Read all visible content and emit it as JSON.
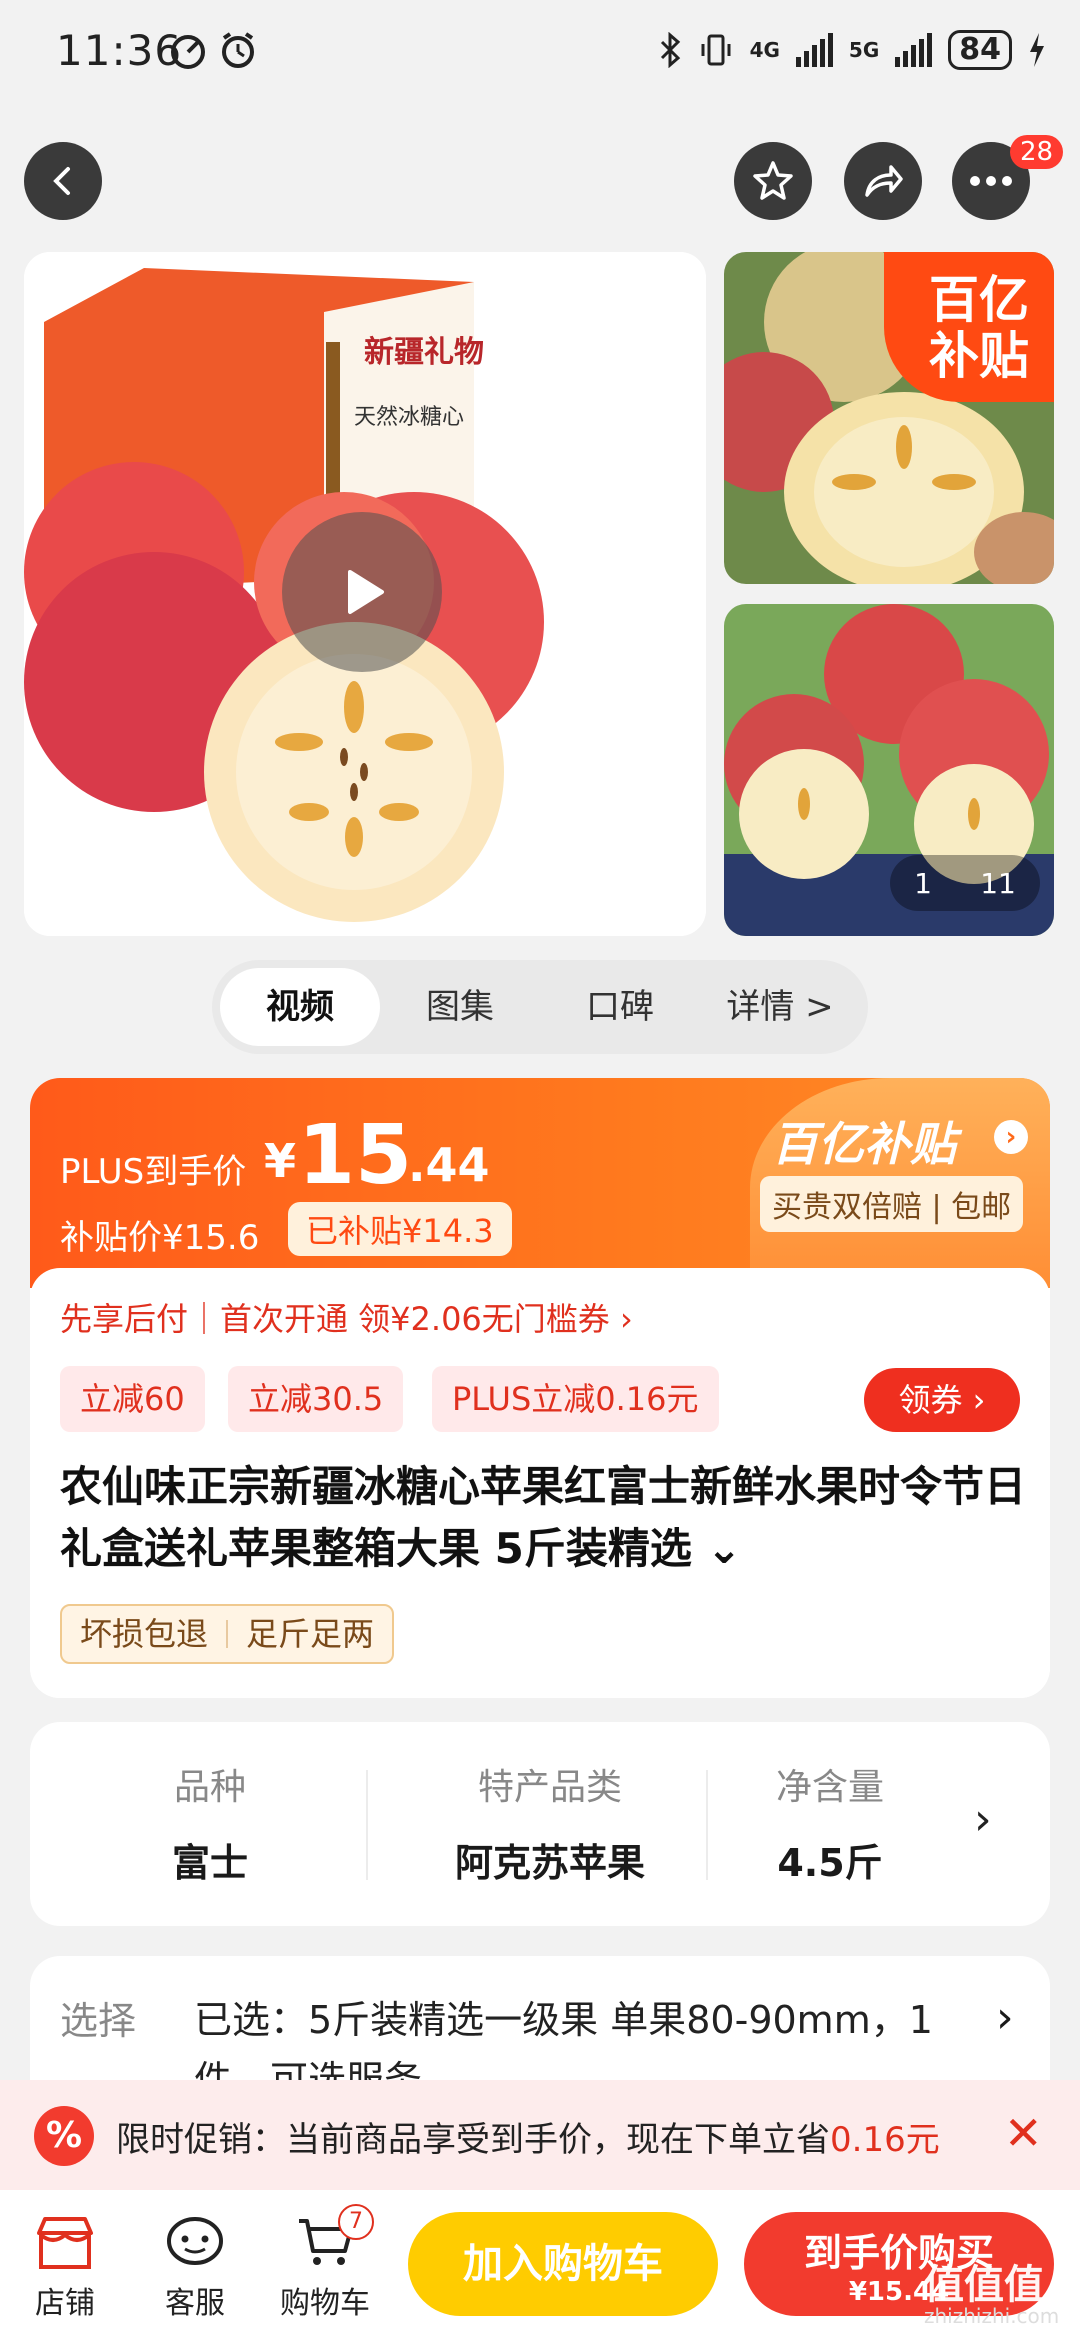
{
  "status_bar": {
    "time": "11:36",
    "network_1": "4G",
    "network_2": "5G",
    "battery": "84"
  },
  "nav": {
    "more_badge": "28"
  },
  "gallery": {
    "corner_badge_line1": "百亿",
    "corner_badge_line2": "补贴",
    "counter_current": "1",
    "counter_total": "11",
    "box_text_1": "新疆礼物",
    "box_text_2": "天然冰糖心"
  },
  "tabs": [
    {
      "label": "视频"
    },
    {
      "label": "图集"
    },
    {
      "label": "口碑"
    },
    {
      "label": "详情 >"
    }
  ],
  "price": {
    "plus_label": "PLUS到手价",
    "yen": "¥",
    "int": "15",
    "dec": ".44",
    "subsidy_price": "补贴价¥15.6",
    "subsidy_tag": "已补贴¥14.3",
    "logo": "百亿补贴",
    "service": "买贵双倍赔 | 包邮"
  },
  "offers": {
    "credit_line": "先享后付｜首次开通 领¥2.06无门槛券 ›",
    "coupons": [
      "立减60",
      "立减30.5",
      "PLUS立减0.16元"
    ],
    "get_coupon": "领券 ›"
  },
  "product": {
    "title": "农仙味正宗新疆冰糖心苹果红富士新鲜水果时令节日礼盒送礼苹果整箱大果 5斤装精选 ⌄",
    "tags": [
      "坏损包退",
      "足斤足两"
    ]
  },
  "attributes": [
    {
      "key": "品种",
      "value": "富士"
    },
    {
      "key": "特产品类",
      "value": "阿克苏苹果"
    },
    {
      "key": "净含量",
      "value": "4.5斤"
    }
  ],
  "selection": {
    "label": "选择",
    "value": "已选：5斤装精选一级果 单果80-90mm，1件，可选服务"
  },
  "promo": {
    "icon": "%",
    "text": "限时促销：当前商品享受到手价，现在下单立省",
    "highlight": "0.16元",
    "close": "✕"
  },
  "bottom": {
    "shop": "店铺",
    "service": "客服",
    "cart": "购物车",
    "cart_count": "7",
    "add_cart": "加入购物车",
    "buy_now": "到手价购买",
    "buy_price": "¥15.44"
  },
  "watermark": {
    "main": "值值值",
    "sub": "zhizhizhi.com"
  },
  "colors": {
    "accent": "#ff5a1a",
    "red": "#f23b2e",
    "yellow": "#ffcc00"
  }
}
